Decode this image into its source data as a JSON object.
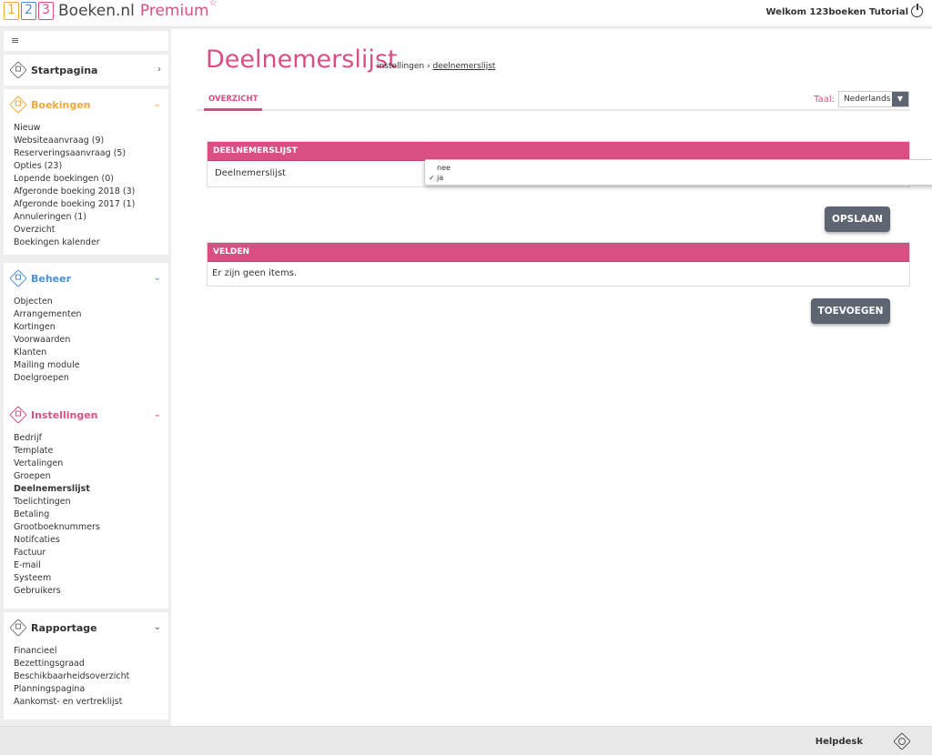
{
  "header": {
    "logo_digits": [
      "1",
      "2",
      "3"
    ],
    "brand": "Boeken.nl",
    "premium": "Premium",
    "star": "☆",
    "welcome": "Welkom 123boeken Tutorial"
  },
  "sidebar": {
    "toggle_icon": "≡",
    "startpagina": {
      "title": "Startpagina",
      "chevron": "›"
    },
    "boekingen": {
      "title": "Boekingen",
      "chevron": "⌄",
      "items": [
        "Nieuw",
        "Websiteaanvraag (9)",
        "Reserveringsaanvraag (5)",
        "Opties (23)",
        "Lopende boekingen (0)",
        "Afgeronde boeking 2018 (3)",
        "Afgeronde boeking 2017 (1)",
        "Annuleringen (1)",
        "Overzicht",
        "Boekingen kalender"
      ]
    },
    "beheer": {
      "title": "Beheer",
      "chevron": "⌄",
      "items": [
        "Objecten",
        "Arrangementen",
        "Kortingen",
        "Voorwaarden",
        "Klanten",
        "Mailing module",
        "Doelgroepen"
      ]
    },
    "instellingen": {
      "title": "Instellingen",
      "chevron": "⌄",
      "items": [
        "Bedrijf",
        "Template",
        "Vertalingen",
        "Groepen",
        "Deelnemerslijst",
        "Toelichtingen",
        "Betaling",
        "Grootboeknummers",
        "Notifcaties",
        "Factuur",
        "E-mail",
        "Systeem",
        "Gebruikers"
      ]
    },
    "rapportage": {
      "title": "Rapportage",
      "chevron": "⌄",
      "items": [
        "Financieel",
        "Bezettingsgraad",
        "Beschikbaarheidsoverzicht",
        "Planningspagina",
        "Aankomst- en vertreklijst"
      ]
    }
  },
  "main": {
    "title": "Deelnemerslijst",
    "breadcrumb": {
      "parent": "instellingen",
      "sep": "›",
      "current": "deelnemerslijst"
    },
    "tab": "OVERZICHT",
    "taal_label": "Taal:",
    "taal_value": "Nederlands",
    "taal_arrow": "▼",
    "card1": {
      "header": "DEELNEMERSLIJST",
      "row_label": "Deelnemerslijst",
      "options": [
        "nee",
        "ja"
      ],
      "selected_check": "✓"
    },
    "save_button": "OPSLAAN",
    "card2": {
      "header": "VELDEN",
      "empty": "Er zijn geen items."
    },
    "add_button": "TOEVOEGEN"
  },
  "footer": {
    "helpdesk": "Helpdesk"
  },
  "colors": {
    "accent": "#d94f84",
    "orange": "#f2a93b",
    "blue": "#4a90d9",
    "button": "#5d6670"
  }
}
